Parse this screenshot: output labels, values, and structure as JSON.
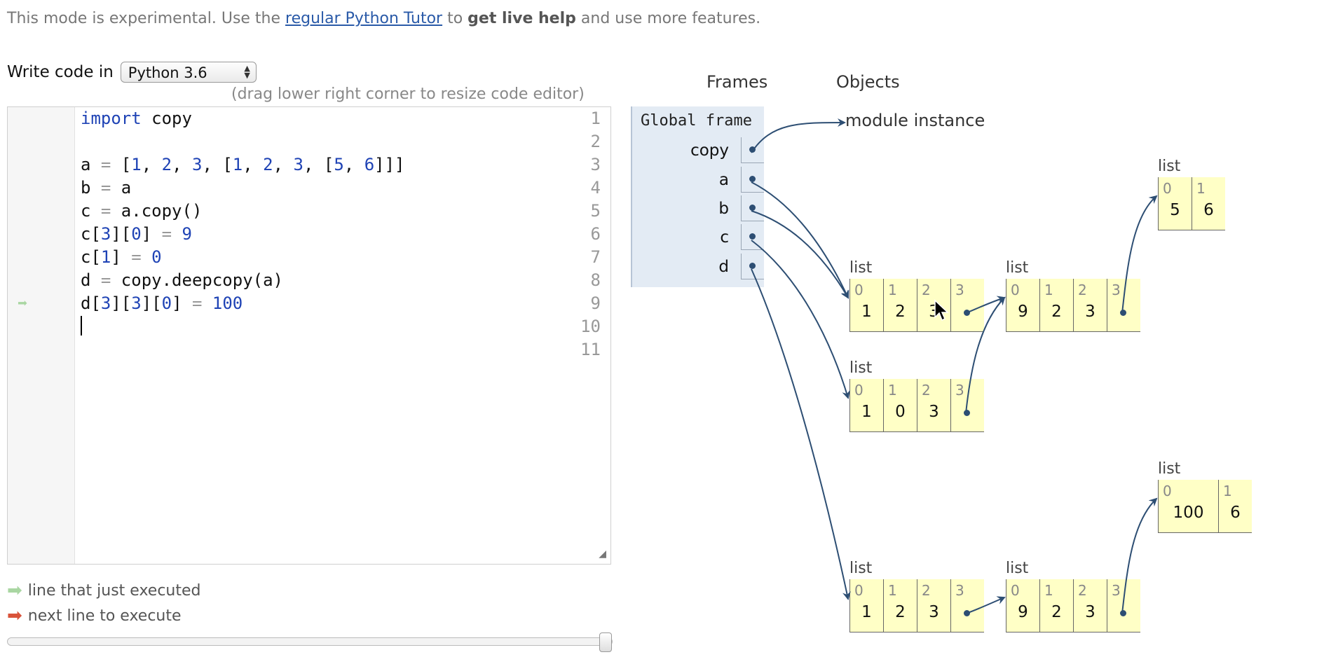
{
  "notice": {
    "pre": "This mode is experimental. Use the ",
    "link": "regular Python Tutor",
    "mid": " to ",
    "bold": "get live help",
    "post": " and use more features."
  },
  "language": {
    "label": "Write code in",
    "selected": "Python 3.6"
  },
  "editor": {
    "resize_hint": "(drag lower right corner to resize code editor)",
    "lines": [
      {
        "n": "1"
      },
      {
        "n": "2"
      },
      {
        "n": "3"
      },
      {
        "n": "4"
      },
      {
        "n": "5"
      },
      {
        "n": "6"
      },
      {
        "n": "7"
      },
      {
        "n": "8"
      },
      {
        "n": "9"
      },
      {
        "n": "10"
      },
      {
        "n": "11"
      }
    ]
  },
  "legend": {
    "just_executed": "line that just executed",
    "next_line": "next line to execute",
    "just_executed_color": "#a9d6a2",
    "next_line_color": "#d9533a"
  },
  "viz": {
    "frames_header": "Frames",
    "objects_header": "Objects",
    "global_frame": "Global frame",
    "variables": [
      "copy",
      "a",
      "b",
      "c",
      "d"
    ],
    "module": "module instance",
    "list_label": "list",
    "lists": {
      "A": {
        "idx": [
          "0",
          "1",
          "2",
          "3"
        ],
        "vals": [
          "1",
          "2",
          "3",
          ""
        ]
      },
      "B": {
        "idx": [
          "0",
          "1",
          "2",
          "3"
        ],
        "vals": [
          "9",
          "2",
          "3",
          ""
        ]
      },
      "C": {
        "idx": [
          "0",
          "1"
        ],
        "vals": [
          "5",
          "6"
        ]
      },
      "D": {
        "idx": [
          "0",
          "1",
          "2",
          "3"
        ],
        "vals": [
          "1",
          "0",
          "3",
          ""
        ]
      },
      "E": {
        "idx": [
          "0",
          "1"
        ],
        "vals": [
          "100",
          "6"
        ]
      },
      "F": {
        "idx": [
          "0",
          "1",
          "2",
          "3"
        ],
        "vals": [
          "1",
          "2",
          "3",
          ""
        ]
      },
      "G": {
        "idx": [
          "0",
          "1",
          "2",
          "3"
        ],
        "vals": [
          "9",
          "2",
          "3",
          ""
        ]
      }
    },
    "pointer_color": "#2d4e73"
  }
}
